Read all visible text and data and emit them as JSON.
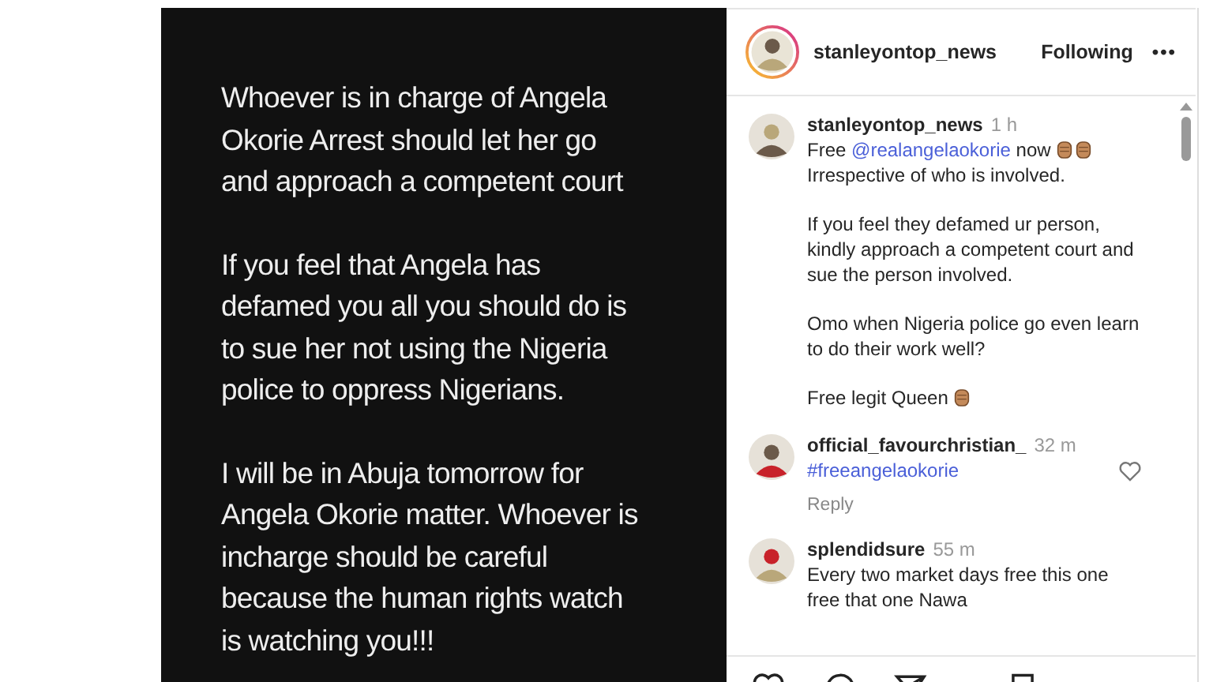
{
  "post_text": {
    "paragraphs": [
      [
        "Whoever is in charge of Angela",
        "Okorie Arrest should let her go",
        "and approach a competent court"
      ],
      [
        "If you feel that Angela has",
        "defamed you all you should do is",
        "to sue her not using the Nigeria",
        "police to oppress Nigerians."
      ],
      [
        "I will be in Abuja tomorrow for",
        "Angela Okorie matter. Whoever is",
        "incharge should be careful",
        "because the human rights watch",
        "is watching you!!!"
      ]
    ]
  },
  "header": {
    "username": "stanleyontop_news",
    "follow_label": "Following",
    "more": "•••"
  },
  "comments": [
    {
      "username": "stanleyontop_news",
      "time": "1 h",
      "paragraphs": [
        [
          [
            {
              "kind": "text",
              "text": "Free "
            },
            {
              "kind": "mention",
              "text": "@realangelaokorie"
            },
            {
              "kind": "text",
              "text": " now "
            },
            {
              "kind": "fist"
            },
            {
              "kind": "fist"
            }
          ],
          [
            {
              "kind": "text",
              "text": "Irrespective of who is involved."
            }
          ]
        ],
        [
          [
            {
              "kind": "text",
              "text": "If you feel they defamed ur person,"
            }
          ],
          [
            {
              "kind": "text",
              "text": "kindly approach a competent court and"
            }
          ],
          [
            {
              "kind": "text",
              "text": "sue the person involved."
            }
          ]
        ],
        [
          [
            {
              "kind": "text",
              "text": "Omo when Nigeria police go even learn"
            }
          ],
          [
            {
              "kind": "text",
              "text": "to do their work well?"
            }
          ]
        ],
        [
          [
            {
              "kind": "text",
              "text": "Free legit Queen "
            },
            {
              "kind": "fist"
            }
          ]
        ]
      ]
    },
    {
      "username": "official_favourchristian_",
      "time": "32 m",
      "paragraphs": [
        [
          [
            {
              "kind": "mention",
              "text": "#freeangelaokorie"
            }
          ]
        ]
      ],
      "reply": "Reply"
    },
    {
      "username": "splendidsure",
      "time": "55 m",
      "paragraphs": [
        [
          [
            {
              "kind": "text",
              "text": "Every two market days free this one"
            }
          ],
          [
            {
              "kind": "text",
              "text": "free that one Nawa"
            }
          ]
        ]
      ]
    }
  ]
}
